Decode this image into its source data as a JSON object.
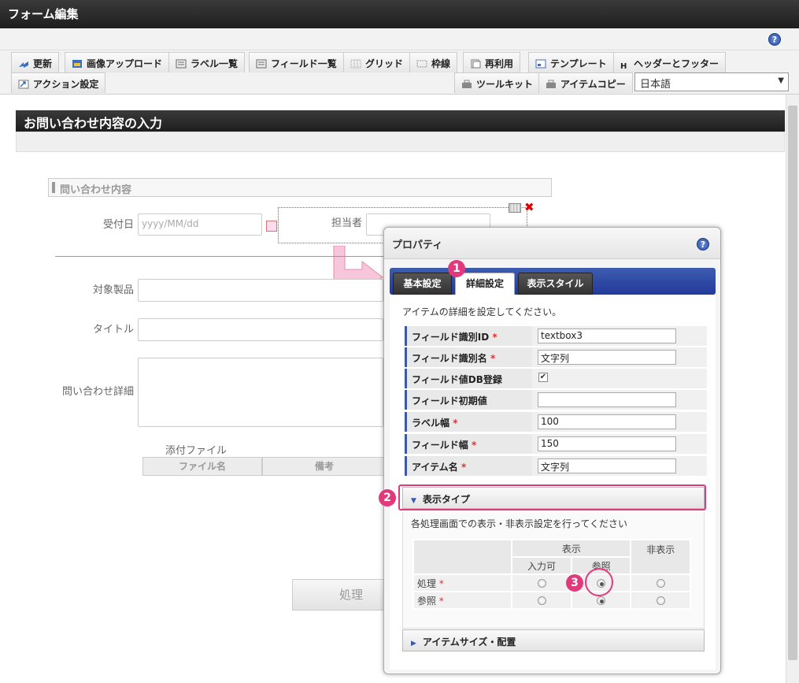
{
  "window": {
    "title": "フォーム編集"
  },
  "toolbar": {
    "row1": [
      {
        "label": "更新",
        "icon": "update-icon"
      },
      {
        "label": "画像アップロード",
        "icon": "image-upload-icon"
      },
      {
        "label": "ラベル一覧",
        "icon": "label-list-icon"
      },
      {
        "label": "フィールド一覧",
        "icon": "field-list-icon"
      },
      {
        "label": "グリッド",
        "icon": "grid-icon"
      },
      {
        "label": "枠線",
        "icon": "border-icon"
      },
      {
        "label": "再利用",
        "icon": "reuse-icon"
      },
      {
        "label": "テンプレート",
        "icon": "template-icon"
      },
      {
        "label": "ヘッダーとフッター",
        "icon": "header-footer-icon"
      }
    ],
    "action": {
      "label": "アクション設定",
      "icon": "action-icon"
    },
    "toolkit": {
      "label": "ツールキット",
      "icon": "toolkit-icon"
    },
    "itemcopy": {
      "label": "アイテムコピー",
      "icon": "item-copy-icon"
    },
    "language": "日本語"
  },
  "form": {
    "title": "お問い合わせ内容の入力",
    "section": "問い合わせ内容",
    "fields": {
      "received_label": "受付日",
      "received_placeholder": "yyyy/MM/dd",
      "owner_label": "担当者",
      "product_label": "対象製品",
      "title_label": "タイトル",
      "detail_label": "問い合わせ詳細",
      "attach_label": "添付ファイル",
      "attach_cols": [
        "ファイル名",
        "備考"
      ]
    },
    "submit_label": "処理"
  },
  "dialog": {
    "title": "プロパティ",
    "tabs": [
      "基本設定",
      "詳細設定",
      "表示スタイル"
    ],
    "description": "アイテムの詳細を設定してください。",
    "rows": [
      {
        "label": "フィールド識別ID",
        "required": true,
        "value": "textbox3"
      },
      {
        "label": "フィールド識別名",
        "required": true,
        "value": "文字列"
      },
      {
        "label": "フィールド値DB登録",
        "required": false,
        "checked": true
      },
      {
        "label": "フィールド初期値",
        "required": false,
        "value": ""
      },
      {
        "label": "ラベル幅",
        "required": true,
        "value": "100"
      },
      {
        "label": "フィールド幅",
        "required": true,
        "value": "150"
      },
      {
        "label": "アイテム名",
        "required": true,
        "value": "文字列"
      }
    ],
    "req_mark": "*",
    "display_type": {
      "heading": "表示タイプ",
      "description": "各処理画面での表示・非表示設定を行ってください",
      "col_show": "表示",
      "col_hide": "非表示",
      "col_input": "入力可",
      "col_ref": "参照",
      "rows": [
        {
          "label": "処理",
          "selected": "ref"
        },
        {
          "label": "参照",
          "selected": "ref"
        }
      ]
    },
    "size_heading": "アイテムサイズ・配置"
  },
  "badges": [
    "1",
    "2",
    "3"
  ],
  "colors": {
    "accent": "#e03a7c",
    "tab_bg": "#2c46a0",
    "header": "#2a2a2a"
  }
}
